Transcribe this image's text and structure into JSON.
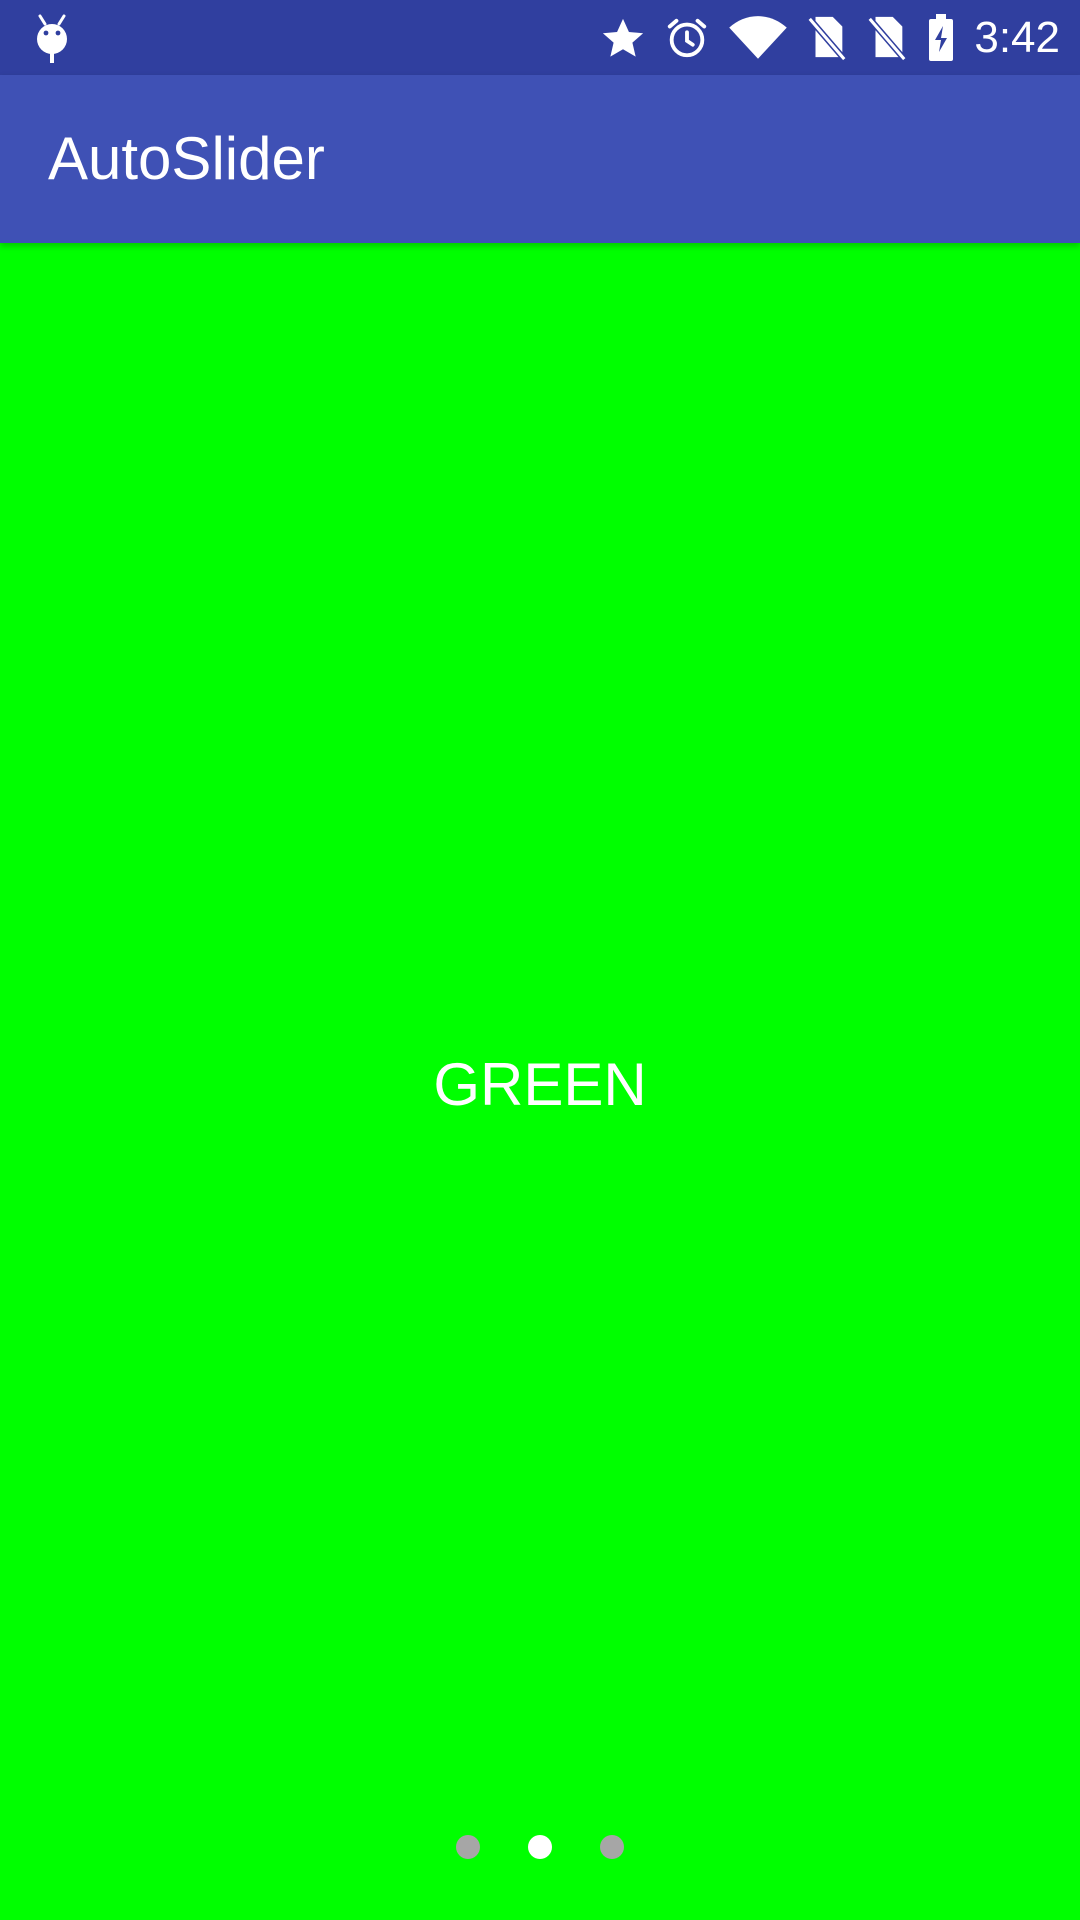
{
  "colors": {
    "status_bar": "#303f9f",
    "app_bar": "#3f51b5",
    "slide_background": "#00ff00",
    "text": "#ffffff",
    "dot_inactive": "#a6a6a6",
    "dot_active": "#ffffff"
  },
  "status_bar": {
    "left_icons": [
      "android-debug-icon"
    ],
    "right_icons": [
      "star-icon",
      "alarm-icon",
      "wifi-icon",
      "no-sim-icon",
      "no-sim-icon",
      "battery-charging-icon"
    ],
    "time": "3:42"
  },
  "app_bar": {
    "title": "AutoSlider"
  },
  "slider": {
    "current_slide_label": "GREEN",
    "slide_count": 3,
    "active_index": 1
  }
}
